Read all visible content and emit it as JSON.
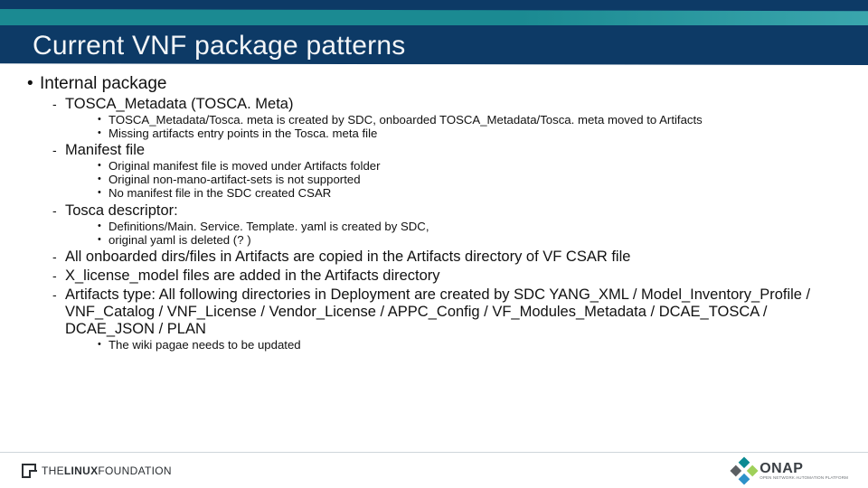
{
  "title": "Current VNF package patterns",
  "bullets": {
    "l1_0": "Internal package",
    "l2_0": "TOSCA_Metadata (TOSCA. Meta)",
    "l3_0a": "TOSCA_Metadata/Tosca. meta is created by SDC, onboarded TOSCA_Metadata/Tosca. meta moved to Artifacts",
    "l3_0b": "Missing artifacts entry points in the Tosca. meta file",
    "l2_1": "Manifest file",
    "l3_1a": "Original manifest file is moved under Artifacts folder",
    "l3_1b": "Original non-mano-artifact-sets is not supported",
    "l3_1c": "No manifest file in the SDC created CSAR",
    "l2_2": "Tosca descriptor:",
    "l3_2a": "Definitions/Main. Service. Template. yaml is created by SDC,",
    "l3_2b": "original yaml is deleted (? )",
    "l2_3": "All onboarded dirs/files in Artifacts are copied in the Artifacts directory of VF CSAR file",
    "l2_4": "X_license_model files are added in the Artifacts directory",
    "l2_5": "Artifacts type: All following directories in Deployment are created by SDC YANG_XML / Model_Inventory_Profile / VNF_Catalog / VNF_License / Vendor_License / APPC_Config / VF_Modules_Metadata / DCAE_TOSCA / DCAE_JSON / PLAN",
    "l3_5a": "The wiki pagae needs to be updated"
  },
  "footer": {
    "lf_thin": "THE",
    "lf_bold1": "LINUX",
    "lf_thin2": "FOUNDATION",
    "onap_big": "ONAP",
    "onap_small": "OPEN NETWORK AUTOMATION PLATFORM"
  }
}
